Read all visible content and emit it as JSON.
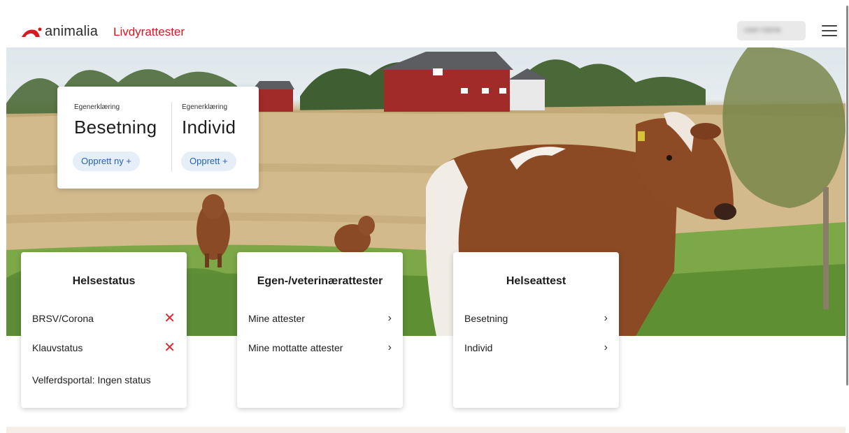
{
  "header": {
    "logo_text": "animalia",
    "app_title": "Livdyrattester",
    "user_chip": "user-name",
    "menu_icon": "hamburger-menu-icon",
    "brand_color": "#d71920"
  },
  "egenerklaring": {
    "left": {
      "small_label": "Egenerklæring",
      "title": "Besetning",
      "button": "Opprett ny +"
    },
    "right": {
      "small_label": "Egenerklæring",
      "title": "Individ",
      "button": "Opprett +"
    }
  },
  "cards": {
    "helsestatus": {
      "title": "Helsestatus",
      "items": [
        {
          "label": "BRSV/Corona",
          "icon": "x-icon"
        },
        {
          "label": "Klauvstatus",
          "icon": "x-icon"
        },
        {
          "label": "Velferdsportal: Ingen status"
        }
      ]
    },
    "egen": {
      "title": "Egen-/veterinærattester",
      "items": [
        {
          "label": "Mine attester",
          "icon": "chevron-right-icon"
        },
        {
          "label": "Mine mottatte attester",
          "icon": "chevron-right-icon"
        }
      ]
    },
    "helseattest": {
      "title": "Helseattest",
      "items": [
        {
          "label": "Besetning",
          "icon": "chevron-right-icon"
        },
        {
          "label": "Individ",
          "icon": "chevron-right-icon"
        }
      ]
    }
  },
  "symbols": {
    "x": "✕",
    "chevron": "›"
  },
  "colors": {
    "accent_blue": "#2563b8",
    "pill_bg": "#e6eef8",
    "error_red": "#e0262d"
  }
}
